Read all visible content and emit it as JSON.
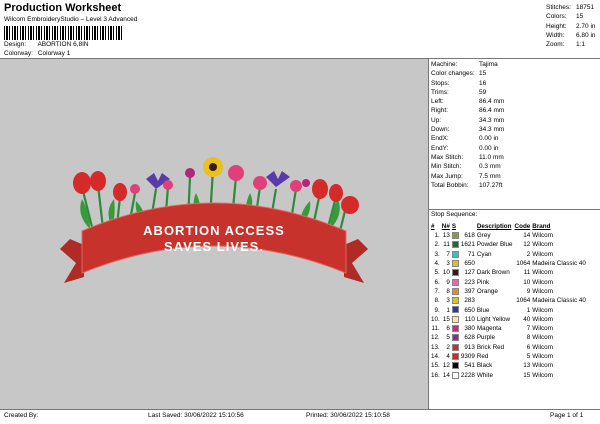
{
  "header": {
    "title": "Production Worksheet",
    "subtitle": "Wilcom EmbroideryStudio – Level 3 Advanced",
    "design_label": "Design:",
    "design_value": "ABORTION 6,8IN",
    "colorway_label": "Colorway:",
    "colorway_value": "Colorway 1"
  },
  "stats": [
    {
      "label": "Stitches:",
      "value": "18751"
    },
    {
      "label": "Colors:",
      "value": "15"
    },
    {
      "label": "Height:",
      "value": "2.70 in"
    },
    {
      "label": "Width:",
      "value": "6.80 in"
    },
    {
      "label": "Zoom:",
      "value": "1:1"
    }
  ],
  "properties": [
    {
      "label": "Machine:",
      "value": "Tajima"
    },
    {
      "label": "Color changes:",
      "value": "15"
    },
    {
      "label": "Stops:",
      "value": "16"
    },
    {
      "label": "Trims:",
      "value": "59"
    },
    {
      "label": "Left:",
      "value": "86.4 mm"
    },
    {
      "label": "Right:",
      "value": "86.4 mm"
    },
    {
      "label": "Up:",
      "value": "34.3 mm"
    },
    {
      "label": "Down:",
      "value": "34.3 mm"
    },
    {
      "label": "EndX:",
      "value": "0.00 in"
    },
    {
      "label": "EndY:",
      "value": "0.00 in"
    },
    {
      "label": "Max Stitch:",
      "value": "11.0 mm"
    },
    {
      "label": "Min Stitch:",
      "value": "0.3 mm"
    },
    {
      "label": "Max Jump:",
      "value": "7.5 mm"
    },
    {
      "label": "Total Bobbin:",
      "value": "107.27ft"
    }
  ],
  "stop_sequence": {
    "title": "Stop Sequence:",
    "columns": [
      "#",
      "N#",
      "S",
      "Description",
      "Code",
      "Brand"
    ],
    "rows": [
      {
        "num": "1.",
        "n": "13",
        "color": "#8a9a3c",
        "s": "618",
        "desc": "Grey",
        "code": "14",
        "brand": "Wilcom"
      },
      {
        "num": "2.",
        "n": "11",
        "color": "#1e6b2a",
        "s": "1621",
        "desc": "Powder Blue",
        "code": "12",
        "brand": "Wilcom"
      },
      {
        "num": "3.",
        "n": "7",
        "color": "#2ec3c8",
        "s": "71",
        "desc": "Cyan",
        "code": "2",
        "brand": "Wilcom"
      },
      {
        "num": "4.",
        "n": "3",
        "color": "#e0c020",
        "s": "650",
        "desc": "",
        "code": "1064",
        "brand": "Madeira Classic 40"
      },
      {
        "num": "5.",
        "n": "10",
        "color": "#3a1a14",
        "s": "127",
        "desc": "Dark Brown",
        "code": "11",
        "brand": "Wilcom"
      },
      {
        "num": "6.",
        "n": "9",
        "color": "#e868a8",
        "s": "223",
        "desc": "Pink",
        "code": "10",
        "brand": "Wilcom"
      },
      {
        "num": "7.",
        "n": "8",
        "color": "#e88a20",
        "s": "397",
        "desc": "Orange",
        "code": "9",
        "brand": "Wilcom"
      },
      {
        "num": "8.",
        "n": "3",
        "color": "#e0c020",
        "s": "283",
        "desc": "",
        "code": "1064",
        "brand": "Madeira Classic 40"
      },
      {
        "num": "9.",
        "n": "1",
        "color": "#2a3aa0",
        "s": "650",
        "desc": "Blue",
        "code": "1",
        "brand": "Wilcom"
      },
      {
        "num": "10.",
        "n": "15",
        "color": "#f0f090",
        "s": "110",
        "desc": "Light Yellow",
        "code": "40",
        "brand": "Wilcom"
      },
      {
        "num": "11.",
        "n": "6",
        "color": "#d02880",
        "s": "380",
        "desc": "Magenta",
        "code": "7",
        "brand": "Wilcom"
      },
      {
        "num": "12.",
        "n": "5",
        "color": "#8a2aa0",
        "s": "628",
        "desc": "Purple",
        "code": "8",
        "brand": "Wilcom"
      },
      {
        "num": "13.",
        "n": "2",
        "color": "#c83028",
        "s": "913",
        "desc": "Brick Red",
        "code": "6",
        "brand": "Wilcom"
      },
      {
        "num": "14.",
        "n": "4",
        "color": "#e02020",
        "s": "9309",
        "desc": "Red",
        "code": "5",
        "brand": "Wilcom"
      },
      {
        "num": "15.",
        "n": "12",
        "color": "#000000",
        "s": "541",
        "desc": "Black",
        "code": "13",
        "brand": "Wilcom"
      },
      {
        "num": "16.",
        "n": "14",
        "color": "#ffffff",
        "s": "2228",
        "desc": "White",
        "code": "15",
        "brand": "Wilcom"
      }
    ]
  },
  "design": {
    "banner_line1": "ABORTION ACCESS",
    "banner_line2": "SAVES LIVES.",
    "banner_color": "#c8322c",
    "background_color": "#c7c7c7"
  },
  "footer": {
    "created_by": "Created By:",
    "last_saved": "Last Saved: 30/06/2022 15:10:56",
    "printed": "Printed: 30/06/2022 15:10:58",
    "page": "Page 1 of 1"
  }
}
